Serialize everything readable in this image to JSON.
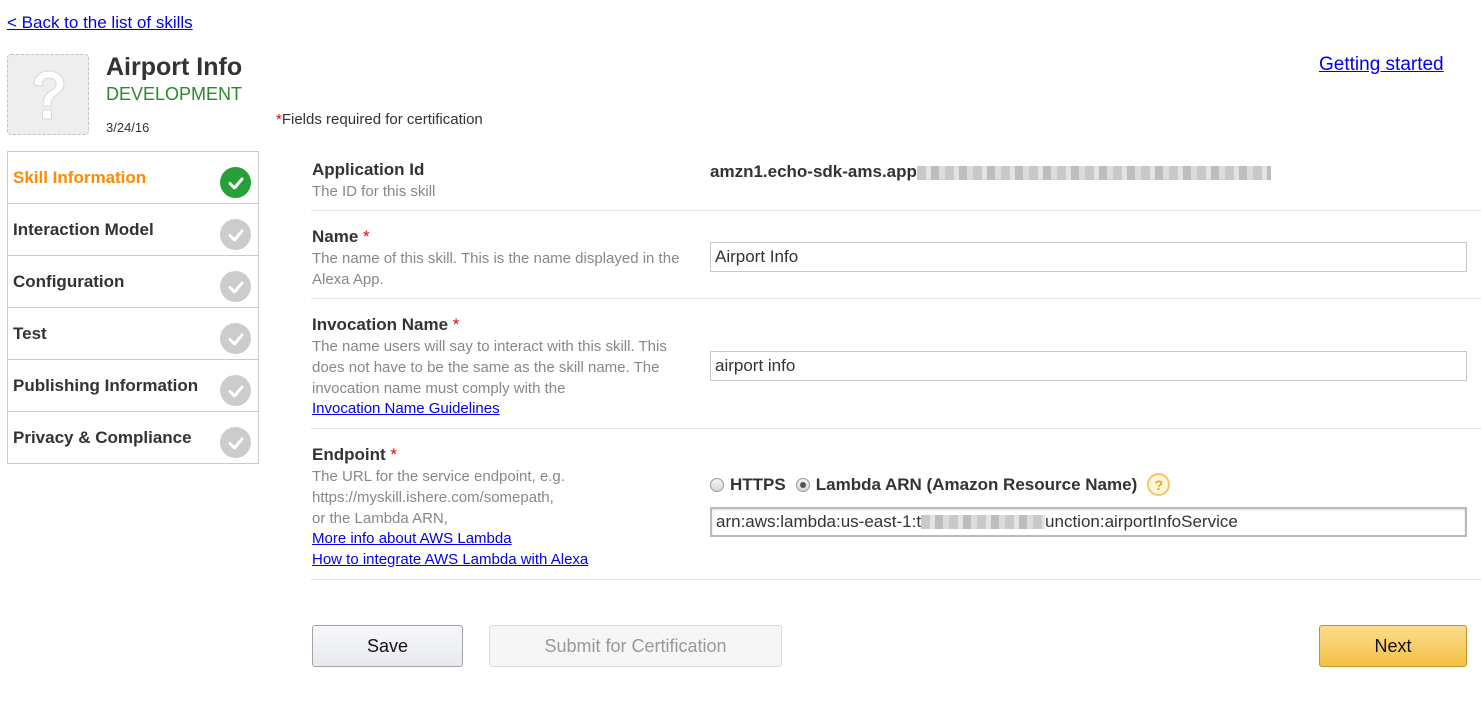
{
  "back_link": "< Back to the list of skills",
  "skill": {
    "title": "Airport Info",
    "status": "DEVELOPMENT",
    "date": "3/24/16",
    "avatar_icon": "question-mark-icon"
  },
  "getting_started": "Getting started",
  "required_note": "Fields required for certification",
  "required_star": "*",
  "sidebar": {
    "items": [
      {
        "label": "Skill Information",
        "active": true
      },
      {
        "label": "Interaction Model",
        "active": false
      },
      {
        "label": "Configuration",
        "active": false
      },
      {
        "label": "Test",
        "active": false
      },
      {
        "label": "Publishing Information",
        "active": false
      },
      {
        "label": "Privacy & Compliance",
        "active": false
      }
    ]
  },
  "form": {
    "app_id": {
      "label": "Application Id",
      "desc": "The ID for this skill",
      "value": "amzn1.echo-sdk-ams.app"
    },
    "name": {
      "label": "Name",
      "desc": "The name of this skill. This is the name displayed in the Alexa App.",
      "value": "Airport Info"
    },
    "invocation": {
      "label": "Invocation Name",
      "desc": "The name users will say to interact with this skill. This does not have to be the same as the skill name. The invocation name must comply with the",
      "link": "Invocation Name Guidelines",
      "value": "airport info"
    },
    "endpoint": {
      "label": "Endpoint",
      "desc_line1": "The URL for the service endpoint, e.g.",
      "desc_line2": "https://myskill.ishere.com/somepath,",
      "desc_line3": "or the Lambda ARN,",
      "link1": "More info about AWS Lambda",
      "link2": "How to integrate AWS Lambda with Alexa",
      "option_https": "HTTPS",
      "option_lambda": "Lambda ARN (Amazon Resource Name)",
      "selected": "Lambda ARN (Amazon Resource Name)",
      "help": "?",
      "value_prefix": "arn:aws:lambda:us-east-1:t",
      "value_suffix": "unction:airportInfoService"
    }
  },
  "buttons": {
    "save": "Save",
    "submit": "Submit for Certification",
    "next": "Next"
  },
  "colors": {
    "active_nav": "#ff8b00",
    "status_green": "#2a8a2a",
    "check_active": "#27a038",
    "check_inactive": "#cccccc",
    "next_button": "#f5c146"
  }
}
